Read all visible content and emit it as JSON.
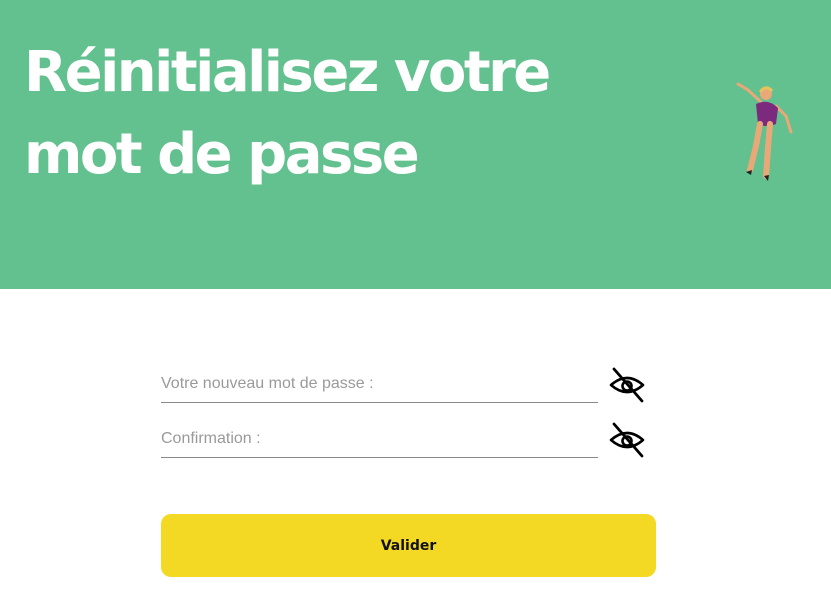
{
  "hero": {
    "title": "Réinitialisez votre mot de passe",
    "background_color": "#63c08f",
    "illustration": "dancing-person-illustration"
  },
  "form": {
    "new_password": {
      "placeholder": "Votre nouveau mot de passe :",
      "value": "",
      "toggle_icon": "eye-off-icon"
    },
    "confirmation": {
      "placeholder": "Confirmation :",
      "value": "",
      "toggle_icon": "eye-off-icon"
    },
    "submit_label": "Valider",
    "submit_color": "#f3d923"
  }
}
